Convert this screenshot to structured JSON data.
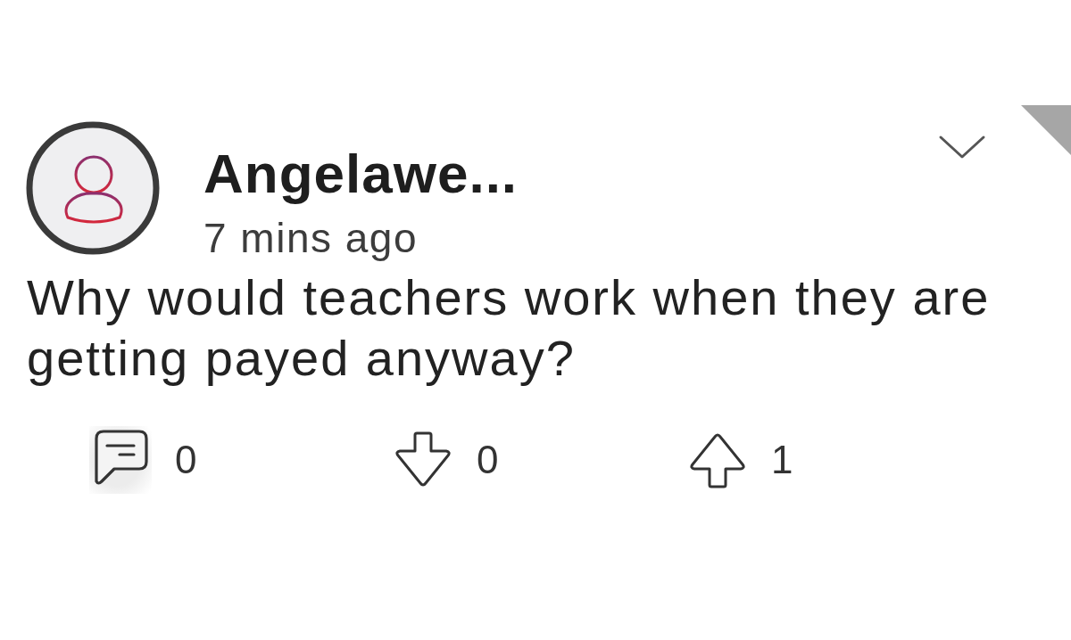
{
  "post": {
    "author": "Angelawe...",
    "time": "7 mins ago",
    "text": "Why would teachers work when they are getting payed anyway?"
  },
  "actions": [
    {
      "kind": "comment",
      "count": "0"
    },
    {
      "kind": "downvote",
      "count": "0"
    },
    {
      "kind": "upvote",
      "count": "1"
    }
  ]
}
